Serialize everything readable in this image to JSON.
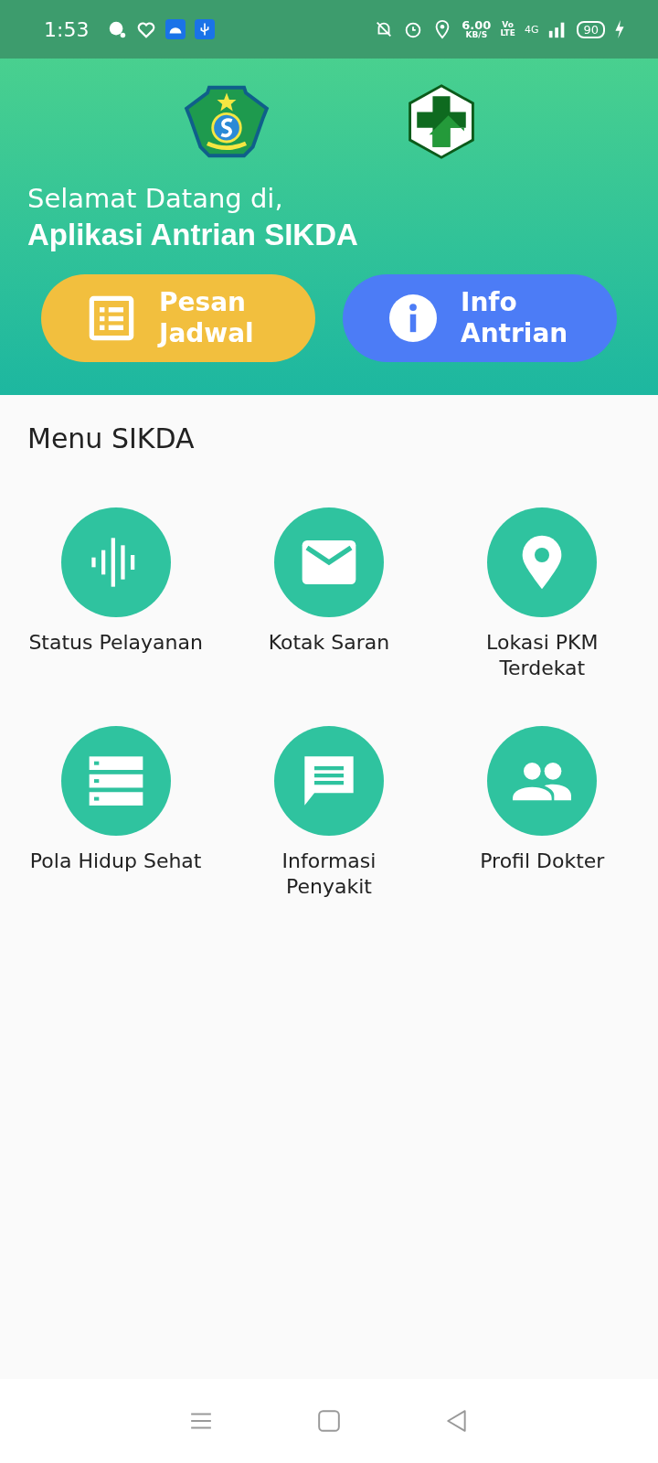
{
  "status_bar": {
    "time": "1:53",
    "speed_value": "6.00",
    "speed_unit": "KB/S",
    "volte_top": "Vo",
    "volte_bottom": "LTE",
    "network": "4G",
    "battery": "90"
  },
  "header": {
    "greeting": "Selamat Datang di,",
    "app_name": "Aplikasi Antrian SIKDA",
    "buttons": [
      {
        "label": "Pesan Jadwal",
        "kind": "list",
        "color": "#f2bf3e"
      },
      {
        "label": "Info Antrian",
        "kind": "info",
        "color": "#4c7cf6"
      }
    ]
  },
  "menu": {
    "title": "Menu SIKDA",
    "items": [
      {
        "label": "Status Pelayanan",
        "kind": "wave"
      },
      {
        "label": "Kotak Saran",
        "kind": "mail"
      },
      {
        "label": "Lokasi PKM Terdekat",
        "kind": "pin"
      },
      {
        "label": "Pola Hidup Sehat",
        "kind": "rows"
      },
      {
        "label": "Informasi Penyakit",
        "kind": "chat"
      },
      {
        "label": "Profil Dokter",
        "kind": "people"
      }
    ]
  }
}
